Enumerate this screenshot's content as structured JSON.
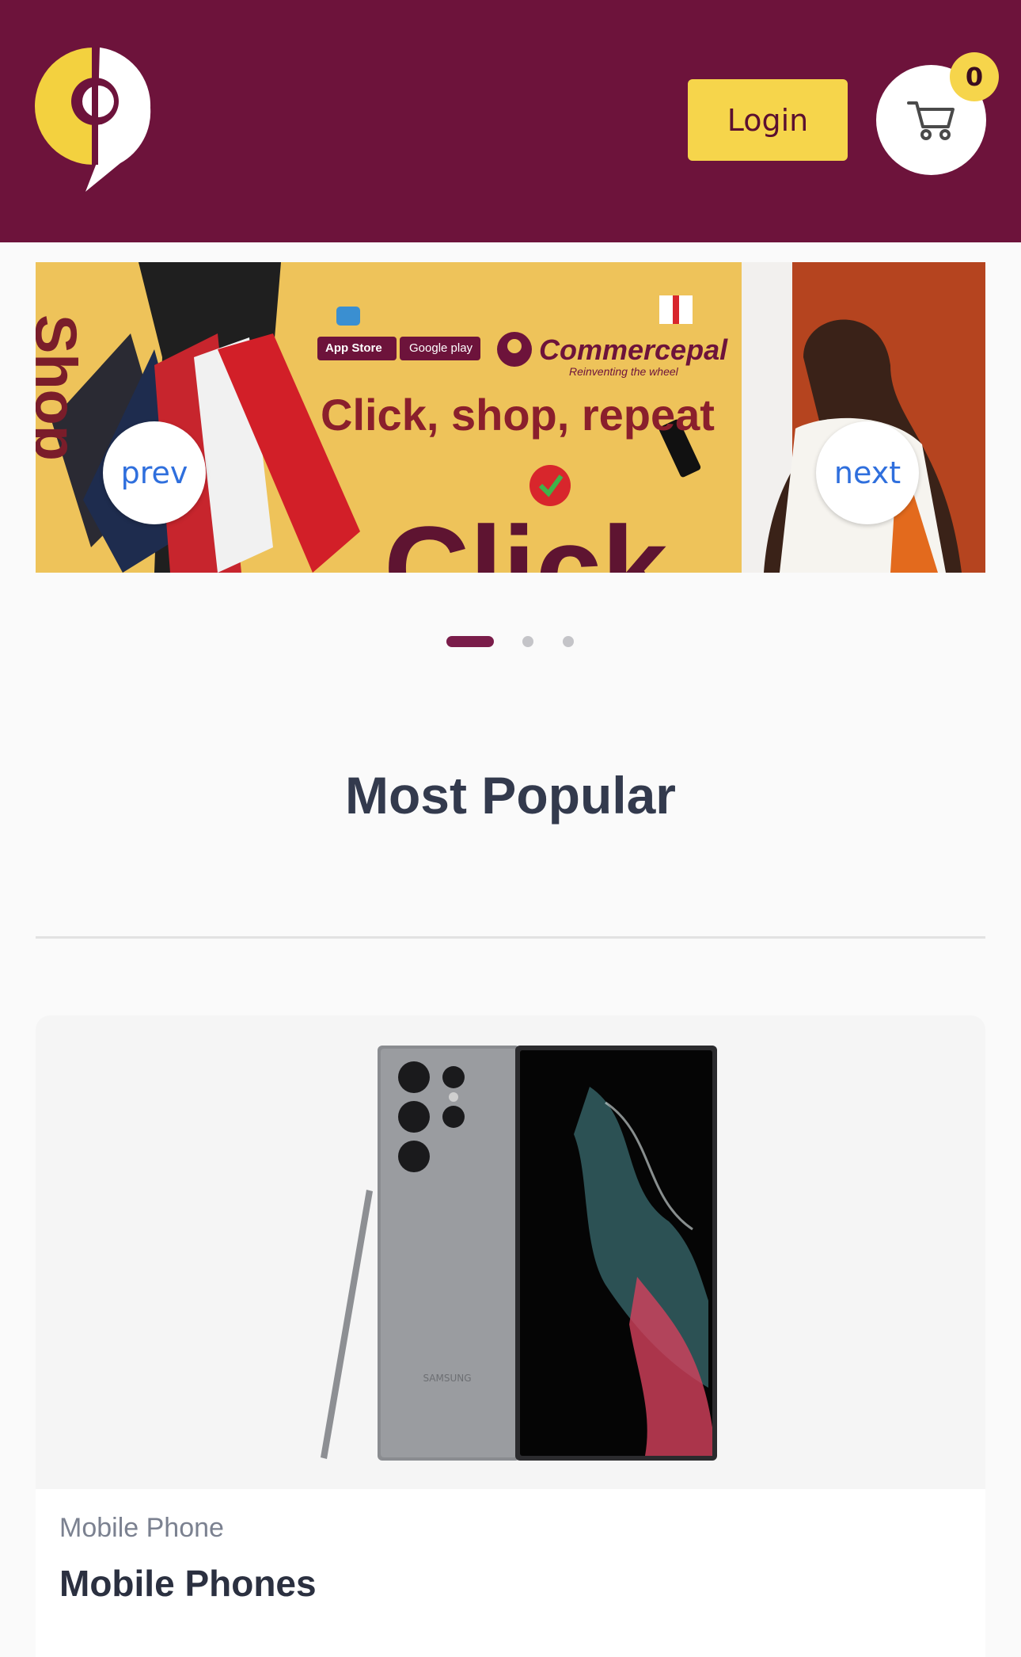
{
  "header": {
    "logo_icon": "commercepal-logo-icon",
    "login_label": "Login",
    "cart_icon": "cart-icon",
    "cart_count": "0",
    "colors": {
      "background": "#6d133b",
      "accent": "#f6d54b"
    }
  },
  "banner": {
    "side_text": "Shop",
    "store_badges": [
      "App Store",
      "Google play"
    ],
    "brand_name": "Commercepal",
    "brand_tagline": "Reinventing the wheel",
    "headline": "Click, shop, repeat",
    "big_text": "Click",
    "prev_label": "prev",
    "next_label": "next"
  },
  "carousel": {
    "slide_count": 3,
    "active_index": 0
  },
  "most_popular": {
    "title": "Most Popular"
  },
  "product_card": {
    "category": "Mobile Phone",
    "title": "Mobile Phones",
    "image_label": "SAMSUNG"
  }
}
